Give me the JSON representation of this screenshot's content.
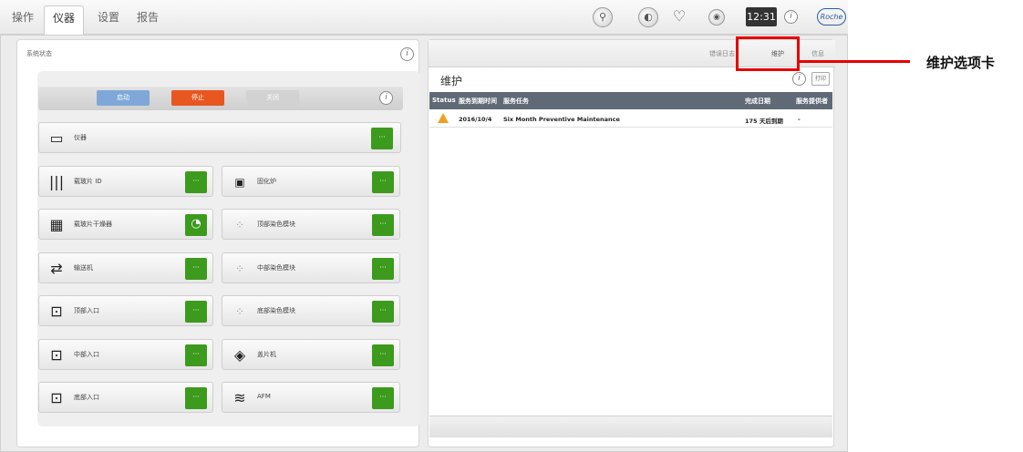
{
  "menu": {
    "tabs": [
      {
        "label": "操作"
      },
      {
        "label": "仪器"
      },
      {
        "label": "设置"
      },
      {
        "label": "报告"
      }
    ]
  },
  "status_icons": [
    "wrench-icon",
    "globe-icon",
    "heart-icon",
    "target-icon"
  ],
  "clock": "12:31",
  "brand": "Roche",
  "left_panel": {
    "title": "系统状态",
    "controls": [
      {
        "label": "启动",
        "color": "#7fa8d8"
      },
      {
        "label": "停止",
        "color": "#e8571f"
      },
      {
        "label": "关闭",
        "color": "#c8c8c8"
      }
    ],
    "instrument": {
      "label": "仪器",
      "button": "···"
    },
    "modules": [
      {
        "label": "载玻片 ID",
        "icon": "barcode-icon",
        "button": "···"
      },
      {
        "label": "固化炉",
        "icon": "oven-icon",
        "button": "···"
      },
      {
        "label": "载玻片干燥器",
        "icon": "dryer-icon",
        "button": "◔"
      },
      {
        "label": "顶部染色模块",
        "icon": "stain-icon",
        "button": "···"
      },
      {
        "label": "输送机",
        "icon": "conveyor-icon",
        "button": "···"
      },
      {
        "label": "中部染色模块",
        "icon": "stain-icon",
        "button": "···"
      },
      {
        "label": "顶部入口",
        "icon": "inlet-icon",
        "button": "···"
      },
      {
        "label": "底部染色模块",
        "icon": "stain-icon",
        "button": "···"
      },
      {
        "label": "中部入口",
        "icon": "inlet-icon",
        "button": "···"
      },
      {
        "label": "盖片机",
        "icon": "layers-icon",
        "button": "···"
      },
      {
        "label": "底部入口",
        "icon": "inlet-icon",
        "button": "···"
      },
      {
        "label": "AFM",
        "icon": "waves-icon",
        "button": "···"
      }
    ]
  },
  "right_panel": {
    "tabs": [
      {
        "label": "错误日志"
      },
      {
        "label": "维护"
      },
      {
        "label": "信息"
      }
    ],
    "heading": "维护",
    "print_label": "打印",
    "columns": [
      "Status",
      "服务到期时间",
      "服务任务",
      "完成日期",
      "服务提供者"
    ],
    "rows": [
      {
        "date": "2016/10/4",
        "task": "Six Month Preventive Maintenance",
        "completed": "175 天后到期",
        "provider": "-"
      }
    ]
  },
  "callout": {
    "label": "维护选项卡"
  }
}
